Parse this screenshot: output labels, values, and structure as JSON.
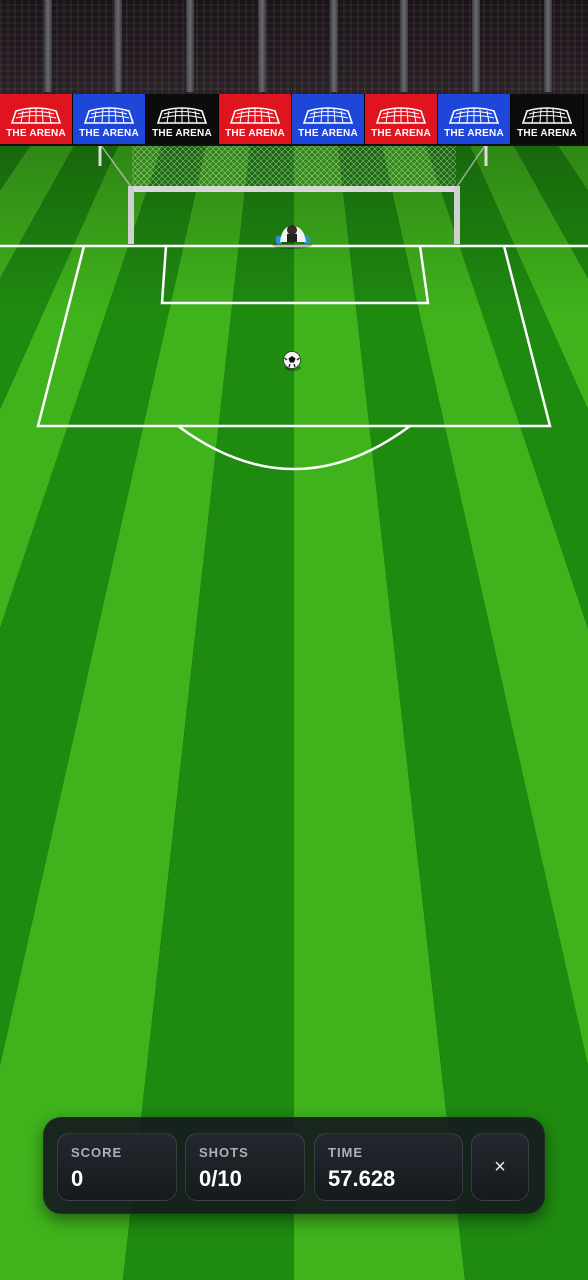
{
  "ad_boards": [
    {
      "text": "THE ARENA",
      "color": "#e0141e"
    },
    {
      "text": "THE ARENA",
      "color": "#1e46d8"
    },
    {
      "text": "THE ARENA",
      "color": "#0c0c0c"
    },
    {
      "text": "THE ARENA",
      "color": "#e0141e"
    },
    {
      "text": "THE ARENA",
      "color": "#1e46d8"
    },
    {
      "text": "THE ARENA",
      "color": "#e0141e"
    },
    {
      "text": "THE ARENA",
      "color": "#1e46d8"
    },
    {
      "text": "THE ARENA",
      "color": "#0c0c0c"
    }
  ],
  "hud": {
    "score_label": "SCORE",
    "score_value": "0",
    "shots_label": "SHOTS",
    "shots_value": "0/10",
    "time_label": "TIME",
    "time_value": "57.628",
    "close_icon": "×"
  },
  "colors": {
    "grass_light": "#3fb31c",
    "grass_dark": "#1f8a10",
    "line": "#ffffff",
    "hud_bg": "#161a1e"
  }
}
